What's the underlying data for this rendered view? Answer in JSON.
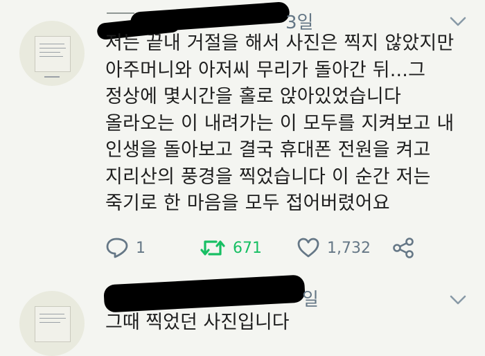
{
  "tweet": {
    "date": "3일",
    "text": "저는 끝내 거절을 해서 사진은 찍지 않았지만\n아주머니와 아저씨 무리가 돌아간 뒤...그\n정상에 몇시간을 홀로 앉아있었습니다\n올라오는 이 내려가는 이 모두를 지켜보고 내\n인생을 돌아보고 결국 휴대폰 전원을 켜고\n지리산의 풍경을 찍었습니다 이 순간 저는\n죽기로 한 마음을 모두 접어버렸어요",
    "reply_count": "1",
    "retweet_count": "671",
    "like_count": "1,732"
  },
  "reply": {
    "date": "일",
    "text": "그때 찍었던 사진입니다"
  },
  "colors": {
    "background": "#f4f5f1",
    "retweet_green": "#17bf63",
    "icon_gray": "#657786"
  },
  "icons": [
    "reply-icon",
    "retweet-icon",
    "like-icon",
    "share-icon",
    "chevron-down-icon"
  ]
}
